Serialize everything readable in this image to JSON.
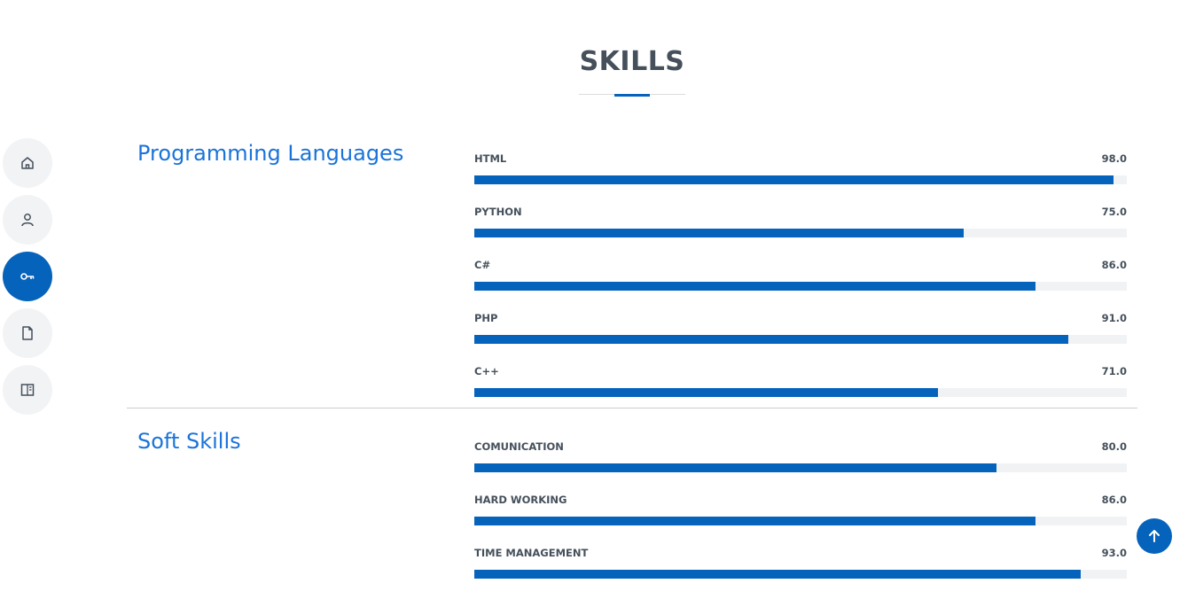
{
  "section": {
    "title": "SKILLS"
  },
  "nav": {
    "items": [
      {
        "icon": "home-icon",
        "active": false
      },
      {
        "icon": "person-icon",
        "active": false
      },
      {
        "icon": "key-icon",
        "active": true
      },
      {
        "icon": "file-icon",
        "active": false
      },
      {
        "icon": "book-icon",
        "active": false
      }
    ]
  },
  "groups": [
    {
      "title": "Programming Languages",
      "skills": [
        {
          "name": "HTML",
          "value": "98.0",
          "percent": 98.0
        },
        {
          "name": "PYTHON",
          "value": "75.0",
          "percent": 75.0
        },
        {
          "name": "C#",
          "value": "86.0",
          "percent": 86.0
        },
        {
          "name": "PHP",
          "value": "91.0",
          "percent": 91.0
        },
        {
          "name": "C++",
          "value": "71.0",
          "percent": 71.0
        }
      ]
    },
    {
      "title": "Soft Skills",
      "skills": [
        {
          "name": "COMUNICATION",
          "value": "80.0",
          "percent": 80.0
        },
        {
          "name": "HARD WORKING",
          "value": "86.0",
          "percent": 86.0
        },
        {
          "name": "TIME MANAGEMENT",
          "value": "93.0",
          "percent": 93.0
        }
      ]
    }
  ],
  "back_to_top": {
    "icon": "arrow-up-icon"
  },
  "colors": {
    "accent": "#0563bb",
    "title_blue": "#1a73d9",
    "text": "#45505b",
    "track": "#f1f2f4"
  }
}
